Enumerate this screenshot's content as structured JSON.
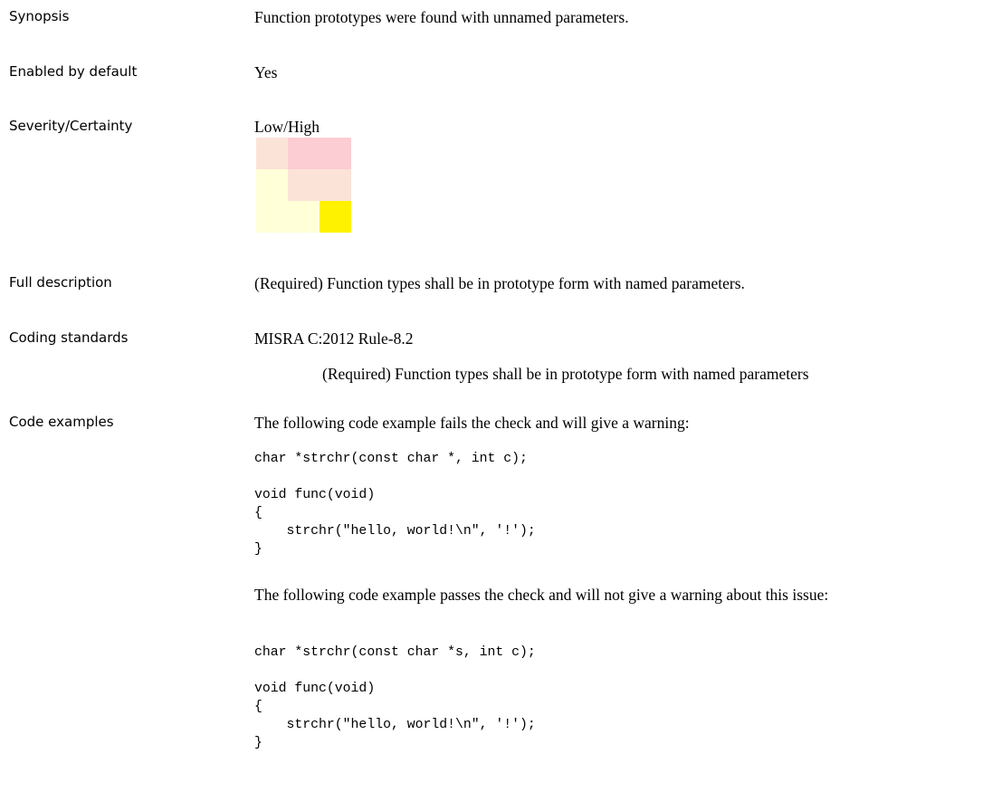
{
  "synopsis": {
    "label": "Synopsis",
    "value": "Function prototypes were found with unnamed parameters."
  },
  "enabled": {
    "label": "Enabled by default",
    "value": "Yes"
  },
  "severity": {
    "label": "Severity/Certainty",
    "value": "Low/High",
    "matrix_colors": [
      "#fbe3d8",
      "#fccdd2",
      "#fccdd2",
      "#ffffd8",
      "#fbe3d8",
      "#fbe3d8",
      "#ffffd8",
      "#ffffd8",
      "#fff200"
    ]
  },
  "full_description": {
    "label": "Full description",
    "value": "(Required) Function types shall be in prototype form with named parameters."
  },
  "coding_standards": {
    "label": "Coding standards",
    "value": "MISRA C:2012 Rule-8.2",
    "detail": "(Required) Function types shall be in prototype form with named parameters"
  },
  "code_examples": {
    "label": "Code examples",
    "fail_intro": "The following code example fails the check and will give a warning:",
    "fail_code": "char *strchr(const char *, int c);\n\nvoid func(void)\n{\n    strchr(\"hello, world!\\n\", '!');\n}",
    "pass_intro": "The following code example passes the check and will not give a warning about this issue:",
    "pass_code": "char *strchr(const char *s, int c);\n\nvoid func(void)\n{\n    strchr(\"hello, world!\\n\", '!');\n}"
  }
}
